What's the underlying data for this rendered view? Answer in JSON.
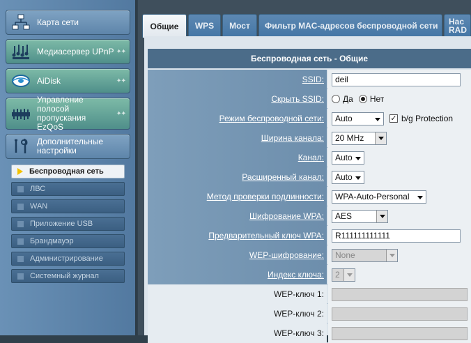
{
  "sidebar": {
    "main_items": [
      {
        "label": "Карта сети",
        "icon": "network-map-icon"
      },
      {
        "label": "Медиасервер UPnP",
        "icon": "media-server-icon"
      },
      {
        "label": "AiDisk",
        "icon": "aidisk-icon"
      },
      {
        "label": "Управление полосой пропускания EzQoS",
        "icon": "ezqos-icon"
      },
      {
        "label": "Дополнительные настройки",
        "icon": "wrench-icon"
      }
    ],
    "sub_items": [
      {
        "label": "Беспроводная сеть",
        "active": true
      },
      {
        "label": "ЛВС"
      },
      {
        "label": "WAN"
      },
      {
        "label": "Приложение USB"
      },
      {
        "label": "Брандмауэр"
      },
      {
        "label": "Администрирование"
      },
      {
        "label": "Системный журнал"
      }
    ]
  },
  "tabs": [
    {
      "label": "Общие",
      "active": true
    },
    {
      "label": "WPS"
    },
    {
      "label": "Мост"
    },
    {
      "label": "Фильтр MAC-адресов беспроводной сети"
    },
    {
      "label": "Нас RAD"
    }
  ],
  "panel": {
    "title": "Беспроводная сеть - Общие"
  },
  "form": {
    "ssid": {
      "label": "SSID:",
      "value": "deil"
    },
    "hide_ssid": {
      "label": "Скрыть SSID:",
      "yes": "Да",
      "no": "Нет",
      "selected": "no"
    },
    "mode": {
      "label": "Режим беспроводной сети:",
      "value": "Auto",
      "bg_protection": "b/g Protection",
      "bg_checked": true
    },
    "bandwidth": {
      "label": "Ширина канала:",
      "value": "20 MHz"
    },
    "channel": {
      "label": "Канал:",
      "value": "Auto"
    },
    "ext_channel": {
      "label": "Расширенный канал:",
      "value": "Auto"
    },
    "auth": {
      "label": "Метод проверки подлинности:",
      "value": "WPA-Auto-Personal"
    },
    "wpa_enc": {
      "label": "Шифрование WPA:",
      "value": "AES"
    },
    "wpa_key": {
      "label": "Предварительный ключ WPA:",
      "value": "R111111111111"
    },
    "wep_enc": {
      "label": "WEP-шифрование:",
      "value": "None"
    },
    "key_index": {
      "label": "Индекс ключа:",
      "value": "2"
    },
    "wep_key1": {
      "label": "WEP-ключ 1:",
      "value": ""
    },
    "wep_key2": {
      "label": "WEP-ключ 2:",
      "value": ""
    },
    "wep_key3": {
      "label": "WEP-ключ 3:",
      "value": ""
    }
  },
  "colors": {
    "sidebar_bg": "#5b82a8",
    "tab_active_bg": "#eef2f6",
    "panel_title_bg": "#4b6c89",
    "label_bg": "#7696b2",
    "active_marker": "#f3c200"
  }
}
